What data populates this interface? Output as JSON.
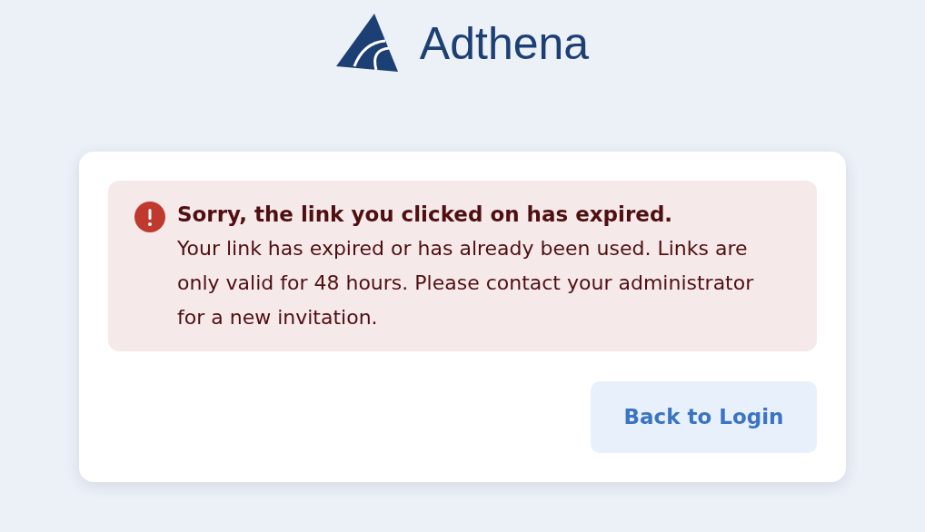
{
  "logo": {
    "text": "Adthena"
  },
  "alert": {
    "kind": "error",
    "title": "Sorry, the link you clicked on has expired.",
    "message": "Your link has expired or has already been used. Links are only valid for 48 hours. Please contact your administrator for a new invitation."
  },
  "buttons": [
    "Back to Login"
  ]
}
